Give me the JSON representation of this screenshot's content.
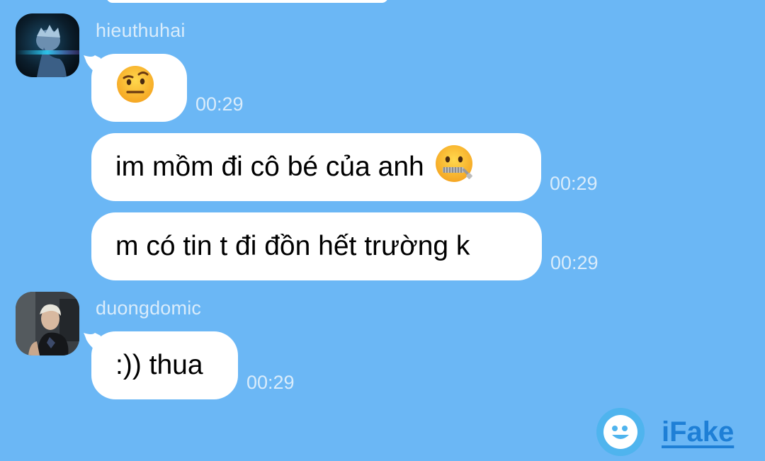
{
  "theme": {
    "background": "#6bb7f5",
    "bubble": "#ffffff",
    "meta_text": "#d9ecfb",
    "brand": "#1e7fd6"
  },
  "messages": [
    {
      "sender": "hieuthuhai",
      "avatar": "avatar-hieuthuhai",
      "text": "",
      "emoji": "face-with-raised-eyebrow-icon",
      "time": "00:29"
    },
    {
      "sender": "",
      "text": "im mồm đi cô bé của anh",
      "emoji": "zipper-mouth-face-icon",
      "time": "00:29"
    },
    {
      "sender": "",
      "text": "m có tin t đi đồn hết trường k",
      "time": "00:29"
    },
    {
      "sender": "duongdomic",
      "avatar": "avatar-duongdomic",
      "text": ":)) thua",
      "time": "00:29"
    }
  ],
  "watermark": {
    "icon": "ifake-logo-icon",
    "label": "iFake"
  }
}
